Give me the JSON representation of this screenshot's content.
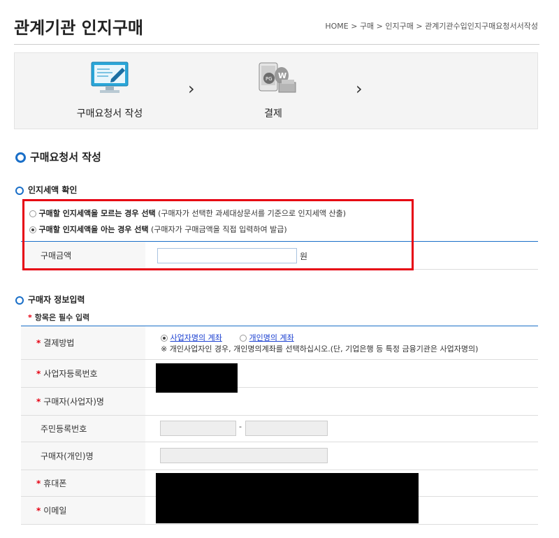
{
  "header": {
    "title": "관계기관 인지구매",
    "breadcrumb": "HOME > 구매 > 인지구매 > 관계기관수입인지구매요청서서작성"
  },
  "steps": [
    {
      "label": "구매요청서 작성",
      "icon": "monitor-pen-icon"
    },
    {
      "label": "결제",
      "icon": "payment-money-icon"
    }
  ],
  "section1": {
    "title": "구매요청서 작성"
  },
  "stamp_amount": {
    "title": "인지세액 확인",
    "option1_bold": "구매할 인지세액을 모르는 경우 선택",
    "option1_note": " (구매자가 선택한 과세대상문서를 기준으로 인지세액 산출)",
    "option2_bold": "구매할 인지세액을 아는 경우 선택",
    "option2_note": " (구매자가 구매금액을 직접 입력하여 발급)",
    "selected": 2,
    "amount_label": "구매금액",
    "amount_value": "",
    "amount_unit": "원"
  },
  "buyer": {
    "title": "구매자 정보입력",
    "required_note": "항목은 필수 입력",
    "required_mark": "*",
    "payment_label": "결제방법",
    "payment_opt1": "사업자명의 계좌",
    "payment_opt2": "개인명의 계좌",
    "payment_selected": 1,
    "payment_note": "※ 개인사업자인 경우, 개인명의계좌를 선택하십시오.(단, 기업은행 등 특정 금융기관은 사업자명의)",
    "bizno_label": "사업자등록번호",
    "bizname_label": "구매자(사업자)명",
    "resident_label": "주민등록번호",
    "resident_sep": "-",
    "personal_label": "구매자(개인)명",
    "phone_label": "휴대폰",
    "email_label": "이메일"
  },
  "colors": {
    "accent": "#1a6fc8",
    "highlight": "#e60012",
    "required": "#e60012"
  }
}
